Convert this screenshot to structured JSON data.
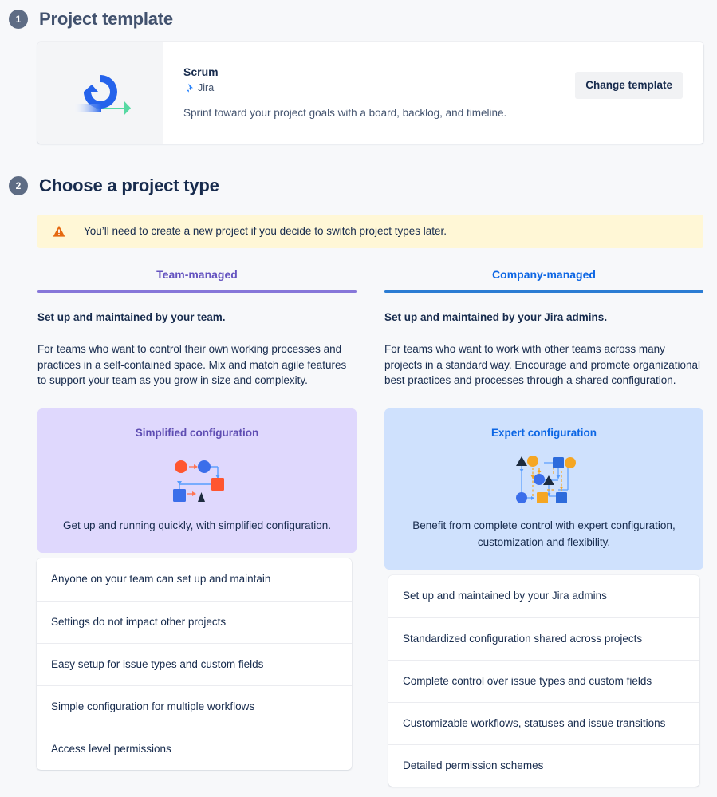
{
  "sections": {
    "step1": {
      "number": "1",
      "title": "Project template"
    },
    "step2": {
      "number": "2",
      "title": "Choose a project type"
    }
  },
  "template_card": {
    "name": "Scrum",
    "product": "Jira",
    "description": "Sprint toward your project goals with a board, backlog, and timeline.",
    "change_button": "Change template",
    "icon": "scrum-loop-arrow-icon",
    "product_icon": "jira-icon"
  },
  "warning": {
    "icon": "warning-triangle-icon",
    "text": "You’ll need to create a new project if you decide to switch project types later."
  },
  "columns": [
    {
      "tab_label": "Team-managed",
      "heading": "Set up and maintained by your team.",
      "description": "For teams who want to control their own working processes and practices in a self-contained space. Mix and match agile features to support your team as you grow in size and complexity.",
      "config_title": "Simplified configuration",
      "config_subtitle": "Get up and running quickly, with simplified configuration.",
      "config_graphic": "simplified-workflow-diagram",
      "features": [
        "Anyone on your team can set up and maintain",
        "Settings do not impact other projects",
        "Easy setup for issue types and custom fields",
        "Simple configuration for multiple workflows",
        "Access level permissions"
      ]
    },
    {
      "tab_label": "Company-managed",
      "heading": "Set up and maintained by your Jira admins.",
      "description": "For teams who want to work with other teams across many projects in a standard way. Encourage and promote organizational best practices and processes through a shared configuration.",
      "config_title": "Expert configuration",
      "config_subtitle": "Benefit from complete control with expert configuration, customization and flexibility.",
      "config_graphic": "expert-workflow-diagram",
      "features": [
        "Set up and maintained by your Jira admins",
        "Standardized configuration shared across projects",
        "Complete control over issue types and custom fields",
        "Customizable workflows, statuses and issue transitions",
        "Detailed permission schemes"
      ]
    }
  ],
  "colors": {
    "page_background": "#f7f8fa",
    "step_badge": "#5e6c84",
    "team_accent": "#6554c0",
    "company_accent": "#0c66e4",
    "team_card_bg": "#dfd8fd",
    "company_card_bg": "#cfe1fd",
    "warning_bg": "#fff7d6",
    "warning_icon": "#e56910",
    "text_primary": "#172b4d",
    "text_secondary": "#44546f"
  }
}
